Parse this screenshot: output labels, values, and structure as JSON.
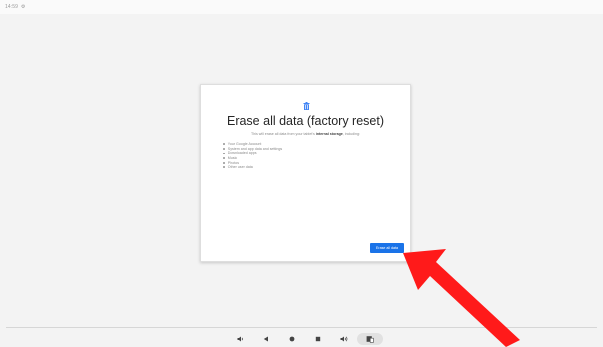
{
  "status_bar": {
    "time": "14:59",
    "icon": "gear-icon"
  },
  "dialog": {
    "icon": "trash-icon",
    "title": "Erase all data (factory reset)",
    "description_prefix": "This will erase all data from your tablet's",
    "description_bold": "internal storage",
    "description_suffix": ", including:",
    "items": [
      "Your Google Account",
      "System and app data and settings",
      "Downloaded apps",
      "Music",
      "Photos",
      "Other user data"
    ],
    "button_label": "Erase all data",
    "accent_color": "#1a73e8"
  },
  "nav_bar": {
    "buttons": [
      "volume-down-icon",
      "back-icon",
      "home-icon",
      "overview-icon",
      "volume-up-icon",
      "screenshot-icon"
    ]
  },
  "annotation": {
    "color": "#ff1a1a",
    "icon": "arrow-icon"
  }
}
